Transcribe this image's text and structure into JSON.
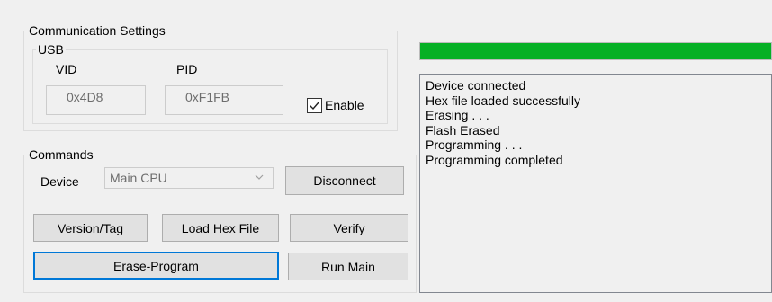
{
  "communication": {
    "group_title": "Communication Settings",
    "usb": {
      "group_title": "USB",
      "vid_label": "VID",
      "pid_label": "PID",
      "vid_value": "0x4D8",
      "pid_value": "0xF1FB",
      "enable_label": "Enable",
      "enable_checked": true
    }
  },
  "commands": {
    "group_title": "Commands",
    "device_label": "Device",
    "device_selected": "Main CPU",
    "buttons": {
      "disconnect": "Disconnect",
      "version_tag": "Version/Tag",
      "load_hex": "Load Hex File",
      "verify": "Verify",
      "erase_program": "Erase-Program",
      "run_main": "Run Main"
    }
  },
  "progress": {
    "value_fraction": 1.0,
    "color": "#06b025"
  },
  "log": {
    "lines": [
      "Device connected",
      "Hex file loaded successfully",
      "Erasing . . .",
      "Flash Erased",
      "Programming . . .",
      "Programming completed"
    ]
  }
}
